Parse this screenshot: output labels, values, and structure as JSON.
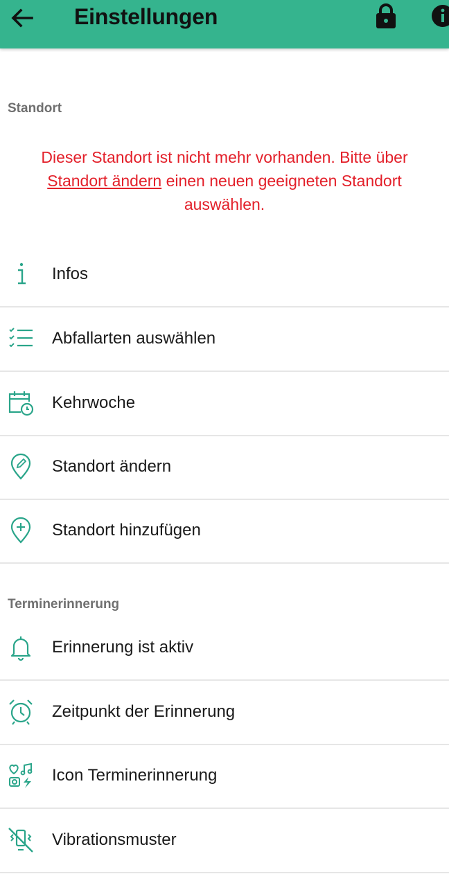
{
  "appbar": {
    "title": "Einstellungen"
  },
  "sections": {
    "standort": "Standort",
    "terminerinnerung": "Terminerinnerung"
  },
  "warning": {
    "before": "Dieser Standort ist nicht mehr vorhanden. Bitte über ",
    "link": "Standort ändern",
    "after": " einen neuen geeigneten Standort auswählen."
  },
  "items": [
    {
      "label": "Infos",
      "icon": "info-icon"
    },
    {
      "label": "Abfallarten auswählen",
      "icon": "checklist-icon"
    },
    {
      "label": "Kehrwoche",
      "icon": "calendar-clock-icon"
    },
    {
      "label": "Standort ändern",
      "icon": "location-edit-icon"
    },
    {
      "label": "Standort hinzufügen",
      "icon": "location-add-icon"
    },
    {
      "label": "Erinnerung ist aktiv",
      "icon": "bell-icon"
    },
    {
      "label": "Zeitpunkt der Erinnerung",
      "icon": "alarm-clock-icon"
    },
    {
      "label": "Icon Terminerinnerung",
      "icon": "icons-collection-icon"
    },
    {
      "label": "Vibrationsmuster",
      "icon": "vibration-off-icon"
    }
  ],
  "colors": {
    "primary": "#35b48e",
    "accent_icon": "#2aa58a",
    "warning": "#e3202a",
    "section_header": "#6f6f6f"
  }
}
